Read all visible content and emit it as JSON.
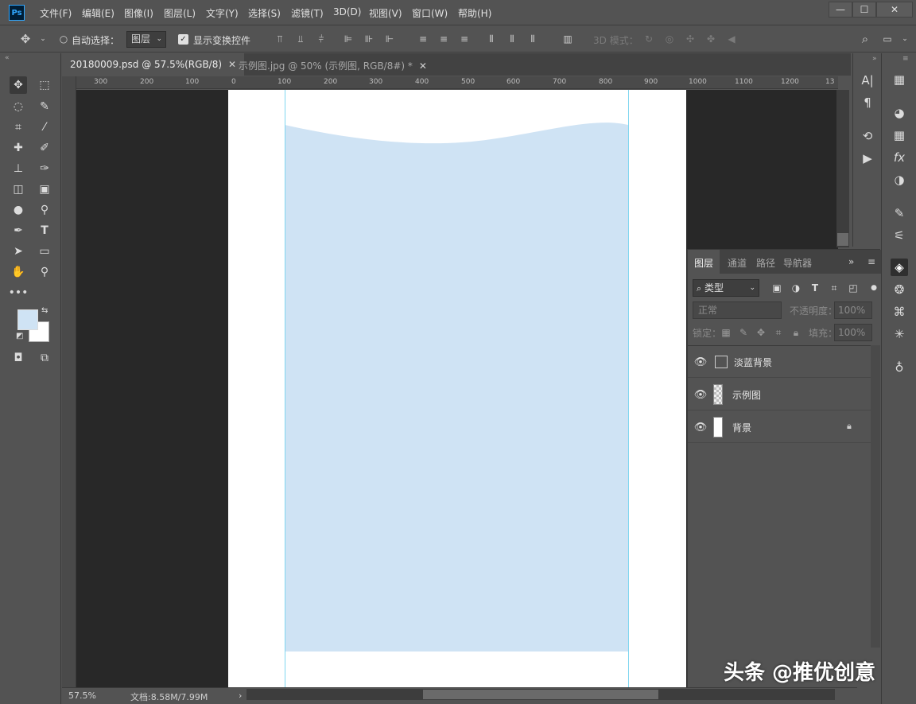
{
  "app": {
    "logo": "Ps"
  },
  "menu": [
    "文件(F)",
    "编辑(E)",
    "图像(I)",
    "图层(L)",
    "文字(Y)",
    "选择(S)",
    "滤镜(T)",
    "3D(D)",
    "视图(V)",
    "窗口(W)",
    "帮助(H)"
  ],
  "window_controls": {
    "minimize": "—",
    "maximize": "☐",
    "close": "✕"
  },
  "options": {
    "auto_select_label": "自动选择：",
    "auto_select_value": "图层",
    "show_transform_label": "显示变换控件",
    "mode_3d_label": "3D 模式："
  },
  "tabs": [
    {
      "label": "20180009.psd @ 57.5%(RGB/8)",
      "close": "✕"
    },
    {
      "label": "示例图.jpg @ 50% (示例图, RGB/8#) *",
      "close": "✕"
    }
  ],
  "ruler_h": [
    "300",
    "200",
    "100",
    "0",
    "100",
    "200",
    "300",
    "400",
    "500",
    "600",
    "700",
    "800",
    "900",
    "1000",
    "1100",
    "1200",
    "13"
  ],
  "status": {
    "zoom": "57.5%",
    "doc_size": "文档:8.58M/7.99M",
    "arrow": "›"
  },
  "layers_panel": {
    "tabs": [
      "图层",
      "通道",
      "路径",
      "导航器"
    ],
    "filter_label": "类型",
    "blend_mode": "正常",
    "opacity_label": "不透明度：",
    "opacity_value": "100%",
    "lock_label": "锁定：",
    "fill_label": "填充：",
    "fill_value": "100%",
    "layers": [
      {
        "name": "淡蓝背景",
        "visible": true
      },
      {
        "name": "示例图",
        "visible": true
      },
      {
        "name": "背景",
        "visible": true,
        "locked": true
      }
    ]
  },
  "colors": {
    "foreground": "#cfe3f4",
    "background": "#ffffff",
    "canvas_fill": "#cfe3f4",
    "guide": "#7fd6f0"
  },
  "watermark": "头条 @推优创意"
}
